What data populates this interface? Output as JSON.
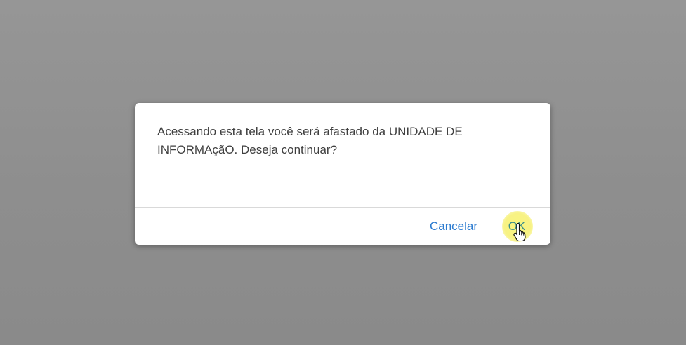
{
  "dialog": {
    "message": "Acessando esta tela você será afastado da UNIDADE DE INFORMAçãO. Deseja continuar?",
    "cancel_label": "Cancelar",
    "ok_label": "OK"
  },
  "colors": {
    "backdrop": "#8f8f8f",
    "dialog_bg": "#ffffff",
    "text": "#3f3f3f",
    "link": "#2b7bd0",
    "click_highlight": "#f6f06e"
  },
  "icons": {
    "cursor": "hand-pointer-icon"
  }
}
